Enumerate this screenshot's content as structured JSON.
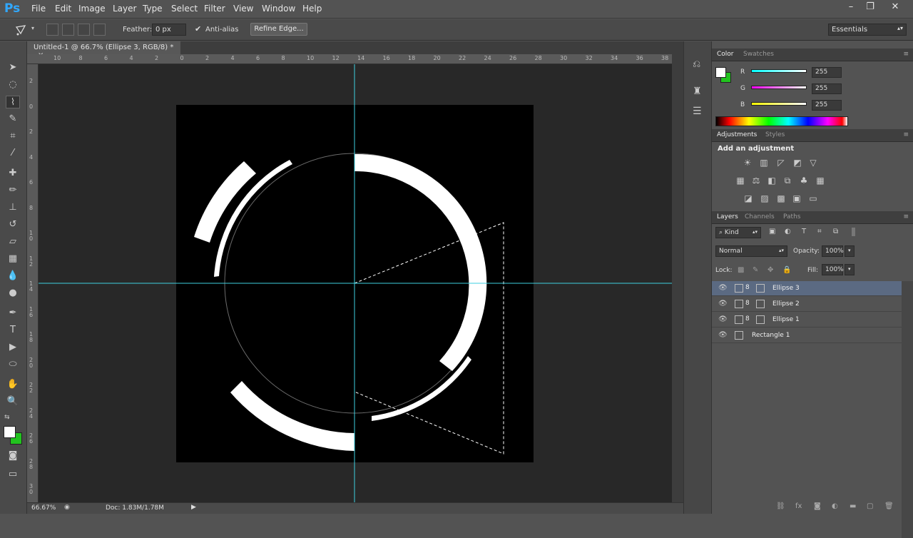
{
  "app": {
    "logo": "Ps"
  },
  "menu": [
    "File",
    "Edit",
    "Image",
    "Layer",
    "Type",
    "Select",
    "Filter",
    "View",
    "Window",
    "Help"
  ],
  "window_controls": [
    "–",
    "❐",
    "✕"
  ],
  "options": {
    "feather_label": "Feather:",
    "feather_value": "0 px",
    "antialias_label": "Anti-alias",
    "refine_edge": "Refine Edge...",
    "workspace": "Essentials"
  },
  "document": {
    "tab_title": "Untitled-1 @ 66.7% (Ellipse 3, RGB/8) *",
    "close": "×"
  },
  "rulers": {
    "top": [
      "10",
      "8",
      "6",
      "4",
      "2",
      "0",
      "2",
      "4",
      "6",
      "8",
      "10",
      "12",
      "14",
      "16",
      "18",
      "20",
      "22",
      "24",
      "26",
      "28",
      "30",
      "32",
      "34",
      "36",
      "38"
    ],
    "left": [
      "2",
      "0",
      "2",
      "4",
      "6",
      "8",
      "1 0",
      "1 2",
      "1 4",
      "1 6",
      "1 8",
      "2 0",
      "2 2",
      "2 4",
      "2 6",
      "2 8",
      "3 0"
    ]
  },
  "status": {
    "zoom": "66.67%",
    "doc": "Doc: 1.83M/1.78M"
  },
  "color_panel": {
    "tabs": [
      "Color",
      "Swatches"
    ],
    "r_label": "R",
    "g_label": "G",
    "b_label": "B",
    "r": "255",
    "g": "255",
    "b": "255",
    "foreground": "#ffffff",
    "background": "#22c31f"
  },
  "adjustments": {
    "tabs": [
      "Adjustments",
      "Styles"
    ],
    "heading": "Add an adjustment"
  },
  "layers_panel": {
    "tabs": [
      "Layers",
      "Channels",
      "Paths"
    ],
    "kind": "Kind",
    "blend_mode": "Normal",
    "opacity_label": "Opacity:",
    "opacity": "100%",
    "lock_label": "Lock:",
    "fill_label": "Fill:",
    "fill": "100%",
    "layers": [
      {
        "name": "Ellipse 3"
      },
      {
        "name": "Ellipse 2"
      },
      {
        "name": "Ellipse 1"
      },
      {
        "name": "Rectangle 1"
      }
    ]
  },
  "colors": {
    "guide": "#3ecfe0",
    "selection": "#5b6a82",
    "accent": "#31a8ff"
  }
}
